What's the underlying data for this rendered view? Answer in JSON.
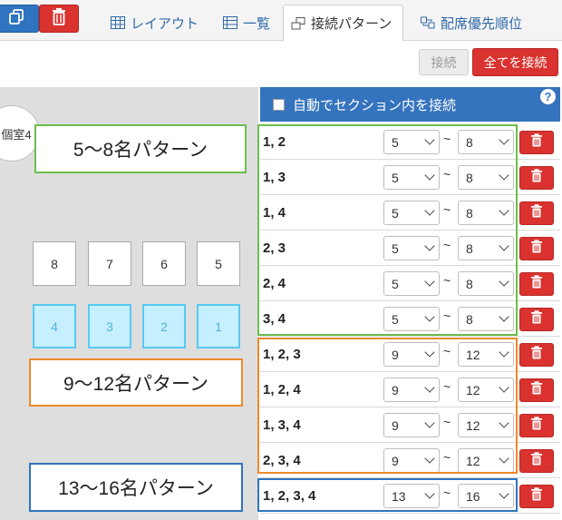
{
  "tabs": [
    {
      "label": "レイアウト",
      "icon": "grid-icon",
      "active": false
    },
    {
      "label": "一覧",
      "icon": "list-icon",
      "active": false
    },
    {
      "label": "接続パターン",
      "icon": "connect-icon",
      "active": true
    },
    {
      "label": "配席優先順位",
      "icon": "priority-icon",
      "active": false
    }
  ],
  "toolbar": {
    "connect_label": "接続",
    "connect_all_label": "全てを接続"
  },
  "canvas": {
    "room_label": "個室4",
    "seats_top": [
      "8",
      "7",
      "6",
      "5"
    ],
    "seats_bottom": [
      "4",
      "3",
      "2",
      "1"
    ],
    "annotations": [
      "5〜8名パターン",
      "9〜12名パターン",
      "13〜16名パターン"
    ]
  },
  "panel": {
    "auto_connect_label": "自動でセクション内を接続",
    "help": "?",
    "tilde": "~",
    "rows": [
      {
        "label": "1, 2",
        "from": "5",
        "to": "8"
      },
      {
        "label": "1, 3",
        "from": "5",
        "to": "8"
      },
      {
        "label": "1, 4",
        "from": "5",
        "to": "8"
      },
      {
        "label": "2, 3",
        "from": "5",
        "to": "8"
      },
      {
        "label": "2, 4",
        "from": "5",
        "to": "8"
      },
      {
        "label": "3, 4",
        "from": "5",
        "to": "8"
      },
      {
        "label": "1, 2, 3",
        "from": "9",
        "to": "12"
      },
      {
        "label": "1, 2, 4",
        "from": "9",
        "to": "12"
      },
      {
        "label": "1, 3, 4",
        "from": "9",
        "to": "12"
      },
      {
        "label": "2, 3, 4",
        "from": "9",
        "to": "12"
      },
      {
        "label": "1, 2, 3, 4",
        "from": "13",
        "to": "16"
      }
    ]
  },
  "colors": {
    "primary": "#3473bd",
    "danger": "#d9322f",
    "group_small": "#6cbf4a",
    "group_medium": "#f0892b",
    "group_large": "#2f74c0"
  }
}
